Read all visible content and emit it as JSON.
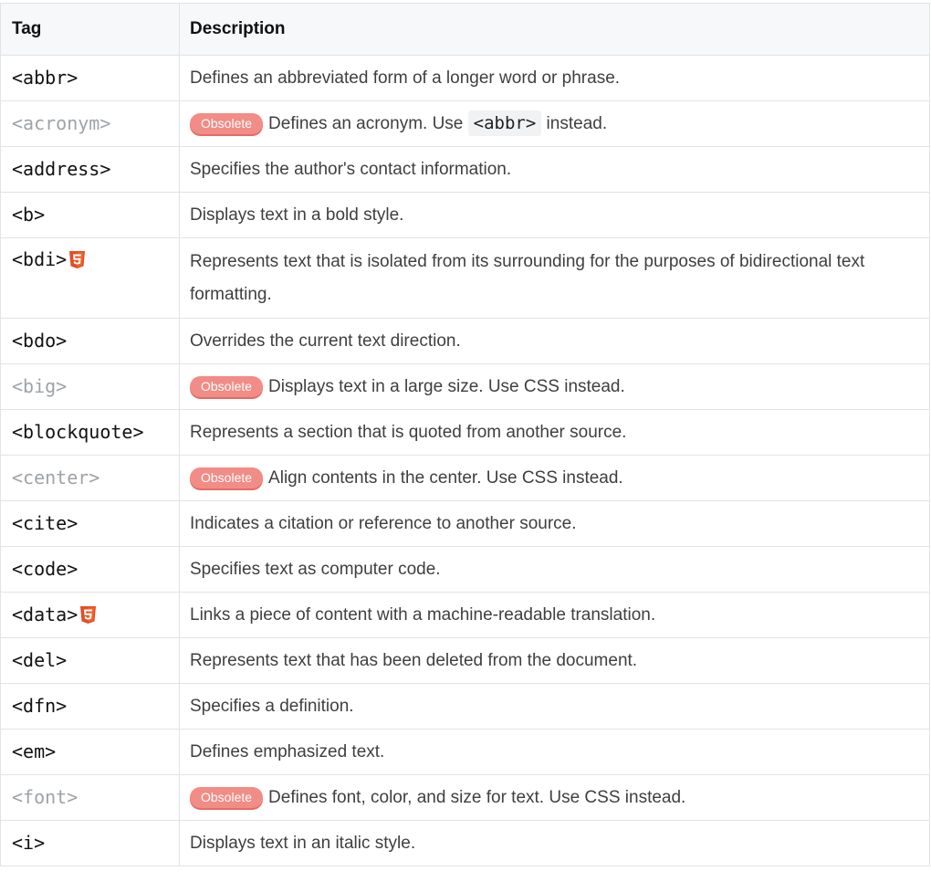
{
  "header": {
    "col_tag": "Tag",
    "col_desc": "Description"
  },
  "obsolete_label": "Obsolete",
  "rows": [
    {
      "tag": "<abbr>",
      "desc": "Defines an abbreviated form of a longer word or phrase."
    },
    {
      "tag": "<acronym>",
      "desc_before": "Defines an acronym. Use ",
      "code": "<abbr>",
      "desc_after": " instead."
    },
    {
      "tag": "<address>",
      "desc": "Specifies the author's contact information."
    },
    {
      "tag": "<b>",
      "desc": "Displays text in a bold style."
    },
    {
      "tag": "<bdi>",
      "desc": "Represents text that is isolated from its surrounding for the purposes of bidirectional text formatting."
    },
    {
      "tag": "<bdo>",
      "desc": "Overrides the current text direction."
    },
    {
      "tag": "<big>",
      "desc": "Displays text in a large size. Use CSS instead."
    },
    {
      "tag": "<blockquote>",
      "desc": "Represents a section that is quoted from another source."
    },
    {
      "tag": "<center>",
      "desc": "Align contents in the center. Use CSS instead."
    },
    {
      "tag": "<cite>",
      "desc": "Indicates a citation or reference to another source."
    },
    {
      "tag": "<code>",
      "desc": "Specifies text as computer code."
    },
    {
      "tag": "<data>",
      "desc": "Links a piece of content with a machine-readable translation."
    },
    {
      "tag": "<del>",
      "desc": "Represents text that has been deleted from the document."
    },
    {
      "tag": "<dfn>",
      "desc": "Specifies a definition."
    },
    {
      "tag": "<em>",
      "desc": "Defines emphasized text."
    },
    {
      "tag": "<font>",
      "desc": "Defines font, color, and size for text. Use CSS instead."
    },
    {
      "tag": "<i>",
      "desc": "Displays text in an italic style."
    }
  ],
  "icons": {
    "html5": "html5-icon"
  },
  "colors": {
    "obsolete_badge": "#f28c86",
    "html5_icon": "#e44d26",
    "obsolete_tag_text": "#9ea3a8"
  }
}
